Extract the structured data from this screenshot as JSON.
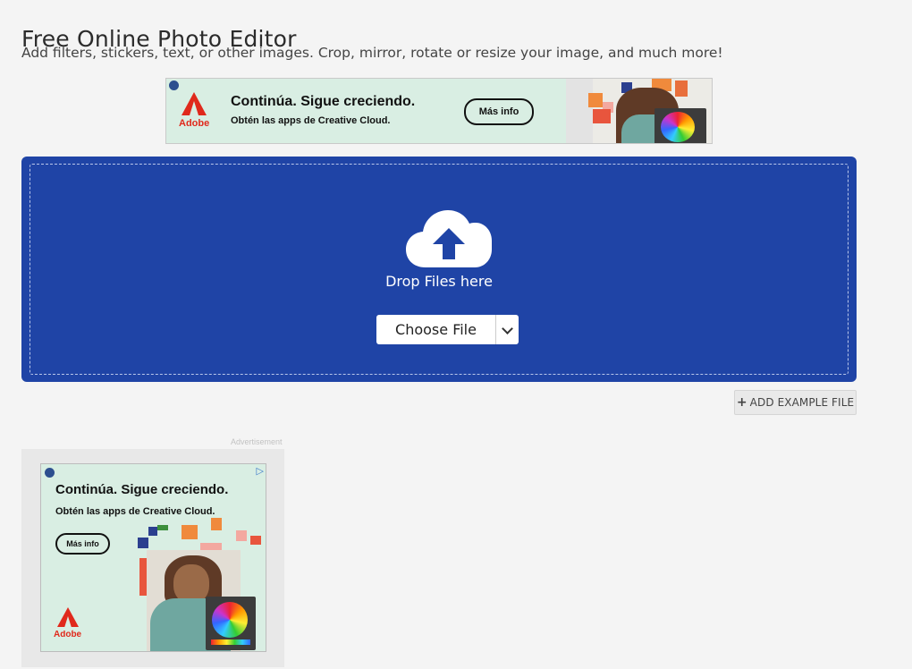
{
  "header": {
    "title": "Free Online Photo Editor",
    "subtitle": "Add filters, stickers, text, or other images. Crop, mirror, rotate or resize your image, and much more!"
  },
  "banner_ad": {
    "headline": "Continúa. Sigue creciendo.",
    "subline": "Obtén las apps de Creative Cloud.",
    "cta": "Más info",
    "brand": "Adobe"
  },
  "upload": {
    "drop_label": "Drop Files here",
    "choose_label": "Choose File",
    "accent_color": "#1f44a6"
  },
  "example_button": {
    "icon": "plus-icon",
    "label": "ADD EXAMPLE FILE"
  },
  "side_ad": {
    "label": "Advertisement",
    "headline": "Continúa. Sigue creciendo.",
    "subline": "Obtén las apps de Creative Cloud.",
    "cta": "Más info",
    "brand": "Adobe"
  }
}
